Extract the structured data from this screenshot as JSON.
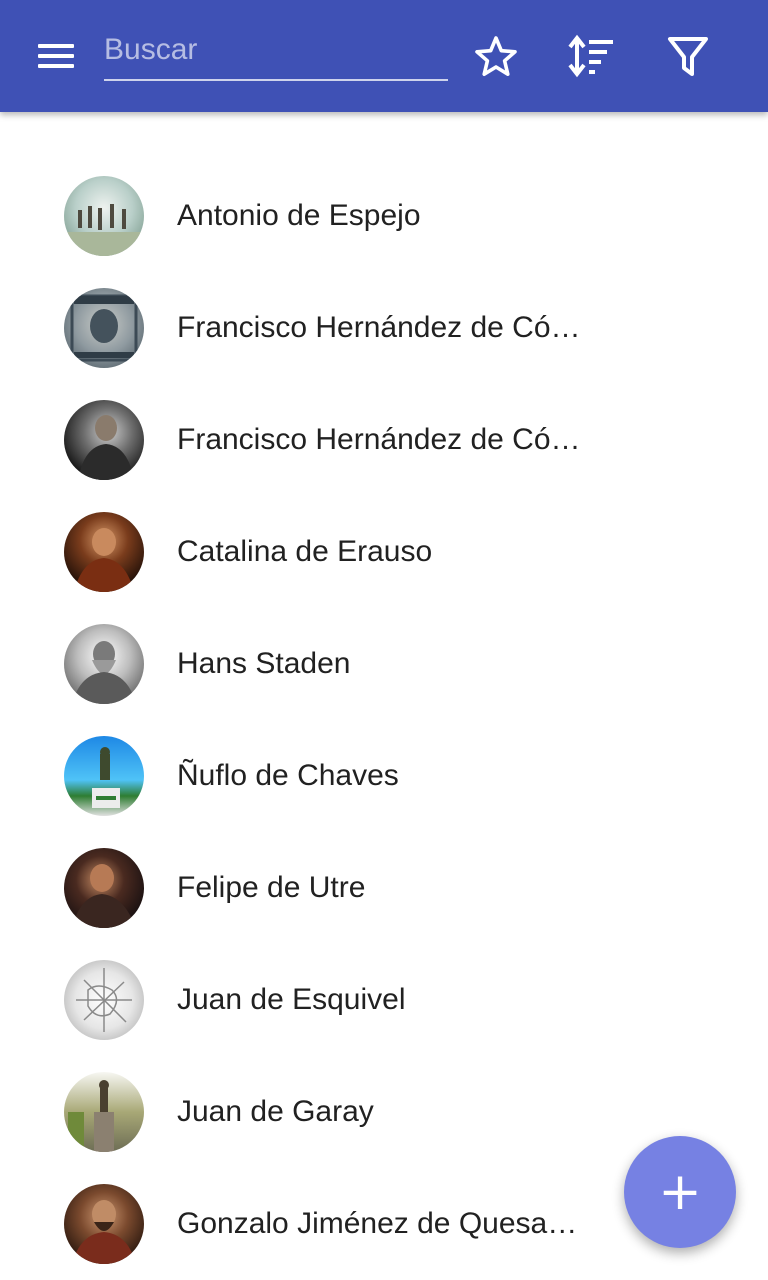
{
  "toolbar": {
    "menu_icon": "hamburger-menu-icon",
    "search": {
      "placeholder": "Buscar",
      "value": ""
    },
    "favorites_icon": "star-outline-icon",
    "sort_icon": "sort-icon",
    "filter_icon": "filter-icon",
    "color": "#3f51b5"
  },
  "list": {
    "items": [
      {
        "name": "Antonio de Espejo",
        "avatar": "portrait-thumbnail"
      },
      {
        "name": "Francisco Hernández de Có…",
        "avatar": "portrait-thumbnail"
      },
      {
        "name": "Francisco Hernández de Có…",
        "avatar": "portrait-thumbnail"
      },
      {
        "name": "Catalina de Erauso",
        "avatar": "portrait-thumbnail"
      },
      {
        "name": "Hans Staden",
        "avatar": "portrait-thumbnail"
      },
      {
        "name": "Ñuflo de Chaves",
        "avatar": "portrait-thumbnail"
      },
      {
        "name": "Felipe de Utre",
        "avatar": "portrait-thumbnail"
      },
      {
        "name": "Juan de Esquivel",
        "avatar": "portrait-thumbnail"
      },
      {
        "name": "Juan de Garay",
        "avatar": "portrait-thumbnail"
      },
      {
        "name": "Gonzalo Jiménez de Quesa…",
        "avatar": "portrait-thumbnail"
      }
    ]
  },
  "fab": {
    "label": "+",
    "icon": "add-icon",
    "color": "#7681e3"
  }
}
